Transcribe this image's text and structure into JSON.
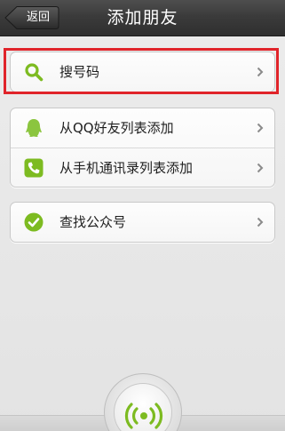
{
  "header": {
    "back_label": "返回",
    "title": "添加朋友"
  },
  "search_section": {
    "item": {
      "label": "搜号码",
      "icon": "search-icon"
    }
  },
  "import_section": {
    "items": [
      {
        "label": "从QQ好友列表添加",
        "icon": "qq-penguin-icon"
      },
      {
        "label": "从手机通讯录列表添加",
        "icon": "phone-icon"
      }
    ]
  },
  "public_section": {
    "item": {
      "label": "查找公众号",
      "icon": "check-circle-icon"
    }
  },
  "bottom": {
    "icon": "radar-signal-icon"
  },
  "colors": {
    "accent_green": "#7dbb21",
    "highlight_red": "#e0242a",
    "header_dark": "#3b3b3b"
  }
}
